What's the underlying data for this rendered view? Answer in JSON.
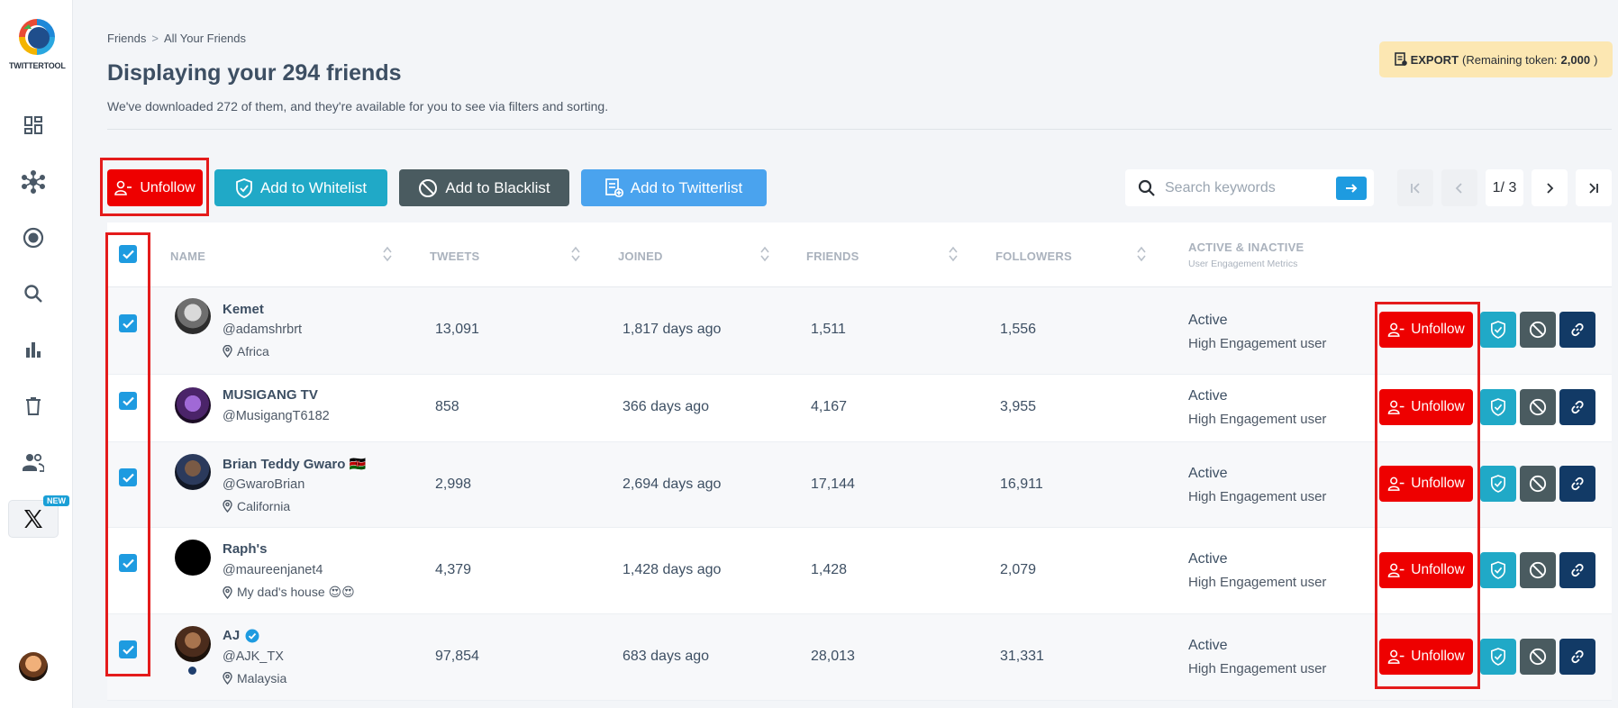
{
  "sidebar": {
    "logo_text": "TWITTERTOOL",
    "new_badge": "NEW"
  },
  "header": {
    "breadcrumb": [
      "Friends",
      "All Your Friends"
    ],
    "title": "Displaying your 294 friends",
    "subtitle": "We've downloaded 272 of them, and they're available for you to see via filters and sorting.",
    "export_label": "EXPORT",
    "export_token_prefix": "(Remaining token:",
    "export_token_value": "2,000",
    "export_token_suffix": ")"
  },
  "toolbar": {
    "unfollow_label": "Unfollow",
    "whitelist_label": "Add to Whitelist",
    "blacklist_label": "Add to Blacklist",
    "twitterlist_label": "Add to Twitterlist",
    "search_placeholder": "Search keywords",
    "page_indicator": "1/ 3"
  },
  "table": {
    "columns": {
      "name": "NAME",
      "tweets": "TWEETS",
      "joined": "JOINED",
      "friends": "FRIENDS",
      "followers": "FOLLOWERS",
      "activity": "ACTIVE & INACTIVE",
      "activity_sub": "User Engagement Metrics"
    },
    "unfollow_label": "Unfollow",
    "rows": [
      {
        "name": "Kemet",
        "handle": "@adamshrbrt",
        "location": "Africa",
        "tweets": "13,091",
        "joined": "1,817 days ago",
        "friends": "1,511",
        "followers": "1,556",
        "status": "Active",
        "engagement": "High Engagement user"
      },
      {
        "name": "MUSIGANG TV",
        "handle": "@MusigangT6182",
        "location": "",
        "tweets": "858",
        "joined": "366 days ago",
        "friends": "4,167",
        "followers": "3,955",
        "status": "Active",
        "engagement": "High Engagement user"
      },
      {
        "name": "Brian Teddy Gwaro 🇰🇪",
        "handle": "@GwaroBrian",
        "location": "California",
        "tweets": "2,998",
        "joined": "2,694 days ago",
        "friends": "17,144",
        "followers": "16,911",
        "status": "Active",
        "engagement": "High Engagement user"
      },
      {
        "name": "Raph's",
        "handle": "@maureenjanet4",
        "location": "My dad's house 😍😍",
        "tweets": "4,379",
        "joined": "1,428 days ago",
        "friends": "1,428",
        "followers": "2,079",
        "status": "Active",
        "engagement": "High Engagement user"
      },
      {
        "name": "AJ",
        "handle": "@AJK_TX",
        "location": "Malaysia",
        "tweets": "97,854",
        "joined": "683 days ago",
        "friends": "28,013",
        "followers": "31,331",
        "status": "Active",
        "engagement": "High Engagement user"
      }
    ]
  }
}
